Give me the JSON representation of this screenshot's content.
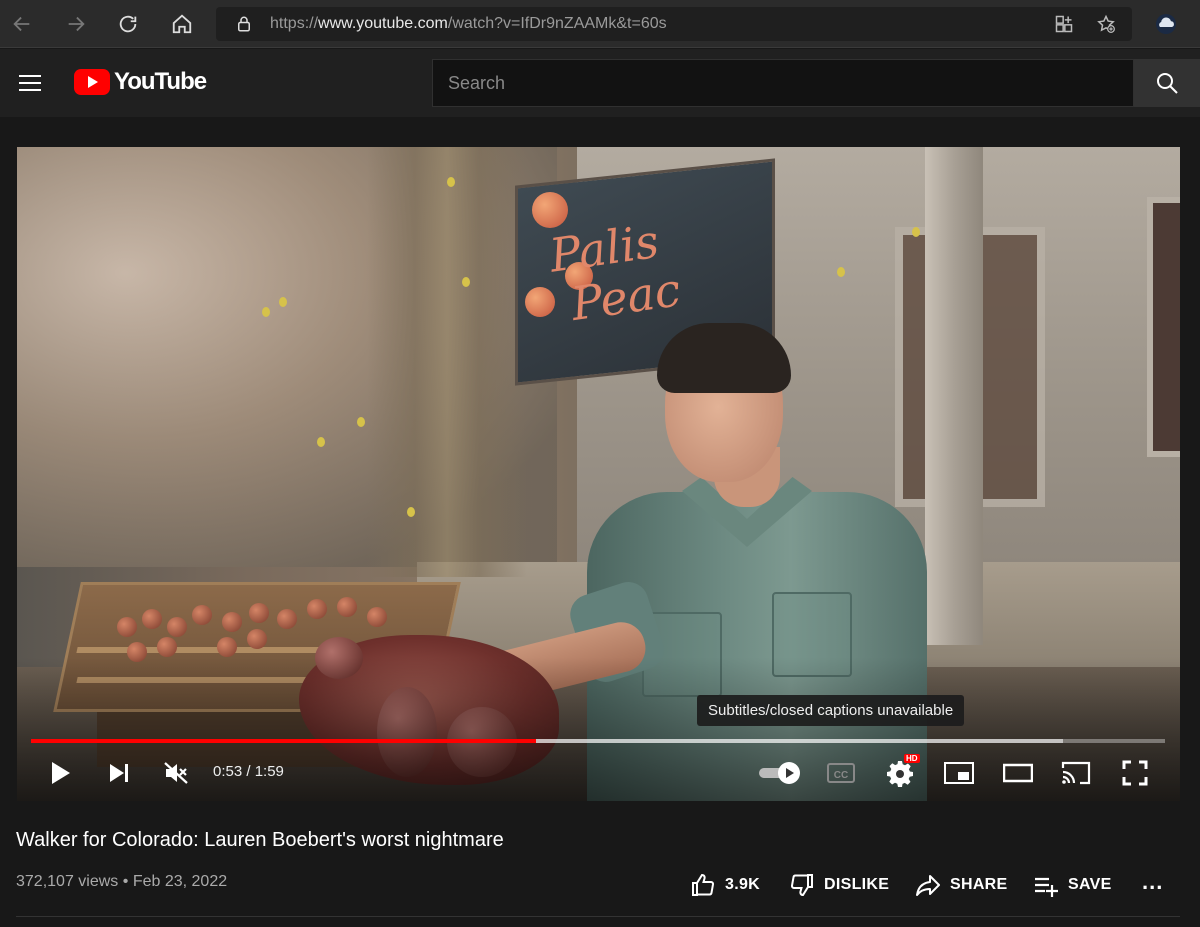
{
  "browser": {
    "url_prefix": "https://",
    "url_domain": "www.youtube.com",
    "url_path": "/watch?v=IfDr9nZAAMk&t=60s"
  },
  "header": {
    "logo_text": "YouTube",
    "search_placeholder": "Search"
  },
  "video": {
    "sign_text": "Palisade Peaches",
    "tooltip": "Subtitles/closed captions unavailable",
    "current_time": "0:53",
    "duration": "1:59",
    "time_display": "0:53 / 1:59",
    "progress_played": 0.445,
    "progress_buffered": 0.91,
    "hd_badge": "HD",
    "autoplay_on": true
  },
  "details": {
    "title": "Walker for Colorado: Lauren Boebert's worst nightmare",
    "views": "372,107 views",
    "separator": "•",
    "date": "Feb 23, 2022",
    "like_count": "3.9K",
    "dislike_label": "DISLIKE",
    "share_label": "SHARE",
    "save_label": "SAVE",
    "more_label": "..."
  },
  "colors": {
    "accent": "#ff0000",
    "background": "#181818",
    "header": "#202020"
  }
}
